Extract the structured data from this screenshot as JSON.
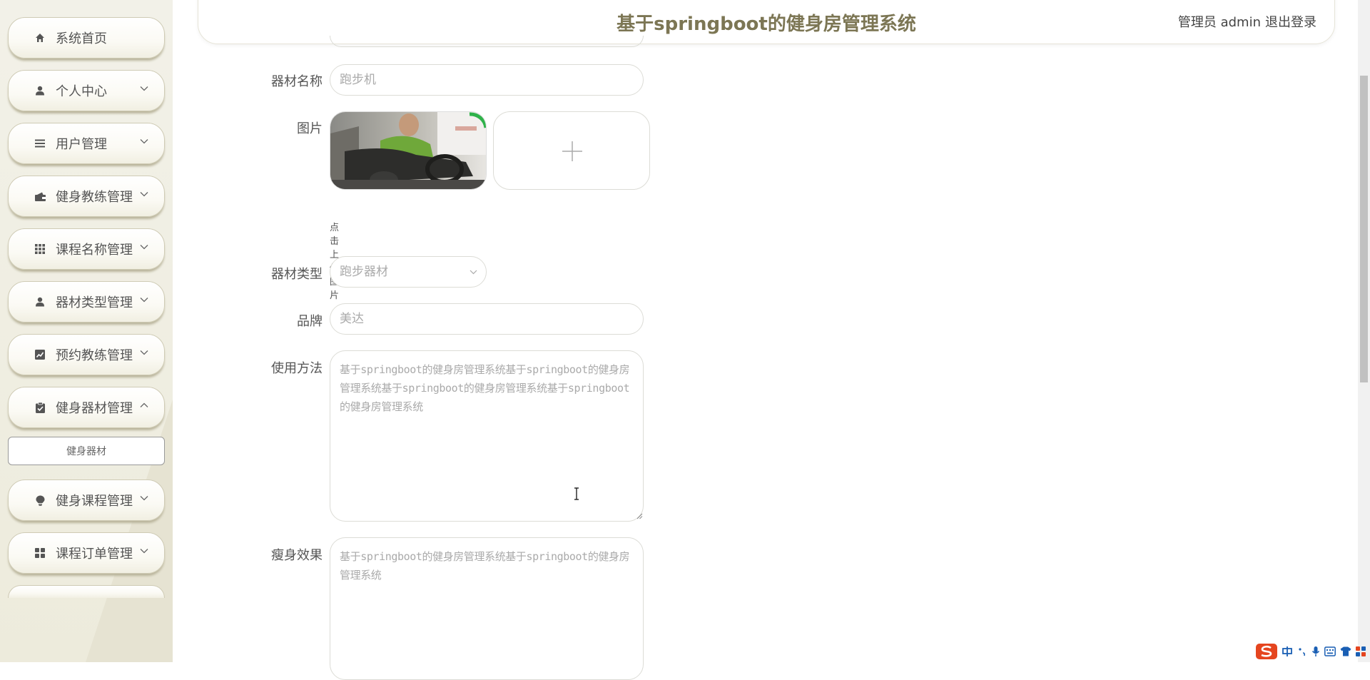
{
  "header": {
    "title": "基于springboot的健身房管理系统",
    "user": "管理员 admin",
    "logout": "退出登录"
  },
  "sidebar": {
    "items": [
      {
        "label": "系统首页",
        "icon": "home-icon",
        "arrow": "none"
      },
      {
        "label": "个人中心",
        "icon": "user-icon",
        "arrow": "down"
      },
      {
        "label": "用户管理",
        "icon": "list-icon",
        "arrow": "down"
      },
      {
        "label": "健身教练管理",
        "icon": "wallet-icon",
        "arrow": "down"
      },
      {
        "label": "课程名称管理",
        "icon": "grid-icon",
        "arrow": "down"
      },
      {
        "label": "器材类型管理",
        "icon": "user-icon",
        "arrow": "down"
      },
      {
        "label": "预约教练管理",
        "icon": "chart-icon",
        "arrow": "down"
      },
      {
        "label": "健身器材管理",
        "icon": "clipboard-icon",
        "arrow": "up"
      },
      {
        "label": "健身课程管理",
        "icon": "bulb-icon",
        "arrow": "down"
      },
      {
        "label": "课程订单管理",
        "icon": "apps-icon",
        "arrow": "down"
      }
    ],
    "submenu": "健身器材"
  },
  "form": {
    "name_label": "器材名称",
    "name_value": "跑步机",
    "image_label": "图片",
    "image_tip": "点击上传图片",
    "type_label": "器材类型",
    "type_value": "跑步器材",
    "brand_label": "品牌",
    "brand_value": "美达",
    "usage_label": "使用方法",
    "usage_value": "基于springboot的健身房管理系统基于springboot的健身房管理系统基于springboot的健身房管理系统基于springboot的健身房管理系统",
    "effect_label": "瘦身效果",
    "effect_value": "基于springboot的健身房管理系统基于springboot的健身房管理系统"
  },
  "colors": {
    "accent": "#7c7654",
    "sidebar_bg": "#eeecdf",
    "icon": "#555555"
  }
}
